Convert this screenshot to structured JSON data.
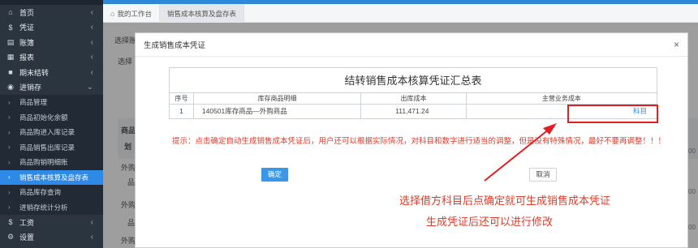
{
  "sidebar": {
    "items": [
      {
        "icon": "home-icon",
        "label": "首页",
        "chevron": "‹"
      },
      {
        "icon": "voucher-icon",
        "label": "凭证",
        "chevron": "‹"
      },
      {
        "icon": "book-icon",
        "label": "账簿",
        "chevron": "‹"
      },
      {
        "icon": "report-icon",
        "label": "报表",
        "chevron": "‹"
      },
      {
        "icon": "period-close-icon",
        "label": "期末结转",
        "chevron": "‹"
      },
      {
        "icon": "inventory-icon",
        "label": "进销存",
        "chevron": "⌄"
      }
    ],
    "sub_items": [
      {
        "label": "商品管理",
        "active": false
      },
      {
        "label": "商品初始化余额",
        "active": false
      },
      {
        "label": "商品购进入库记录",
        "active": false
      },
      {
        "label": "商品销售出库记录",
        "active": false
      },
      {
        "label": "商品购销明细账",
        "active": false
      },
      {
        "label": "销售成本核算及盘存表",
        "active": true
      },
      {
        "label": "商品库存查询",
        "active": false
      },
      {
        "label": "进销存统计分析",
        "active": false
      }
    ],
    "bottom_items": [
      {
        "icon": "salary-icon",
        "label": "工资",
        "chevron": "‹"
      },
      {
        "icon": "settings-icon",
        "label": "设置",
        "chevron": "‹"
      }
    ]
  },
  "tabs": [
    {
      "label": "我的工作台"
    },
    {
      "label": "销售成本核算及盘存表"
    }
  ],
  "background": {
    "label1": "选择账",
    "label2": "选择",
    "col_label": "商品",
    "col_label2": "划",
    "row_labels": [
      "外购",
      "品",
      "外购",
      "品",
      "外购",
      "品"
    ],
    "right_values": [
      "00",
      "00",
      "00"
    ]
  },
  "modal": {
    "title": "生成销售成本凭证",
    "close": "×",
    "summary_title": "结转销售成本核算凭证汇总表",
    "headers": {
      "no": "序号",
      "item": "库存商品明细",
      "cost": "出库成本",
      "main": "主营业务成本"
    },
    "row": {
      "no": "1",
      "item": "140501库存商品—外购商品",
      "cost": "111,471.24",
      "subject_link": "科目"
    },
    "hint": "提示：点击确定自动生成销售成本凭证后，用户还可以根据实际情况，对科目和数字进行适当的调整，但是没有特殊情况，最好不要再调整！！！",
    "ok_label": "确定",
    "cancel_label": "取消"
  },
  "annotation": {
    "line1": "选择借方科目后点确定就可生成销售成本凭证",
    "line2": "生成凭证后还可以进行修改"
  },
  "colors": {
    "accent": "#2e8ae6",
    "annotation_red": "#e23b2a",
    "sidebar_bg": "#2b3540"
  }
}
